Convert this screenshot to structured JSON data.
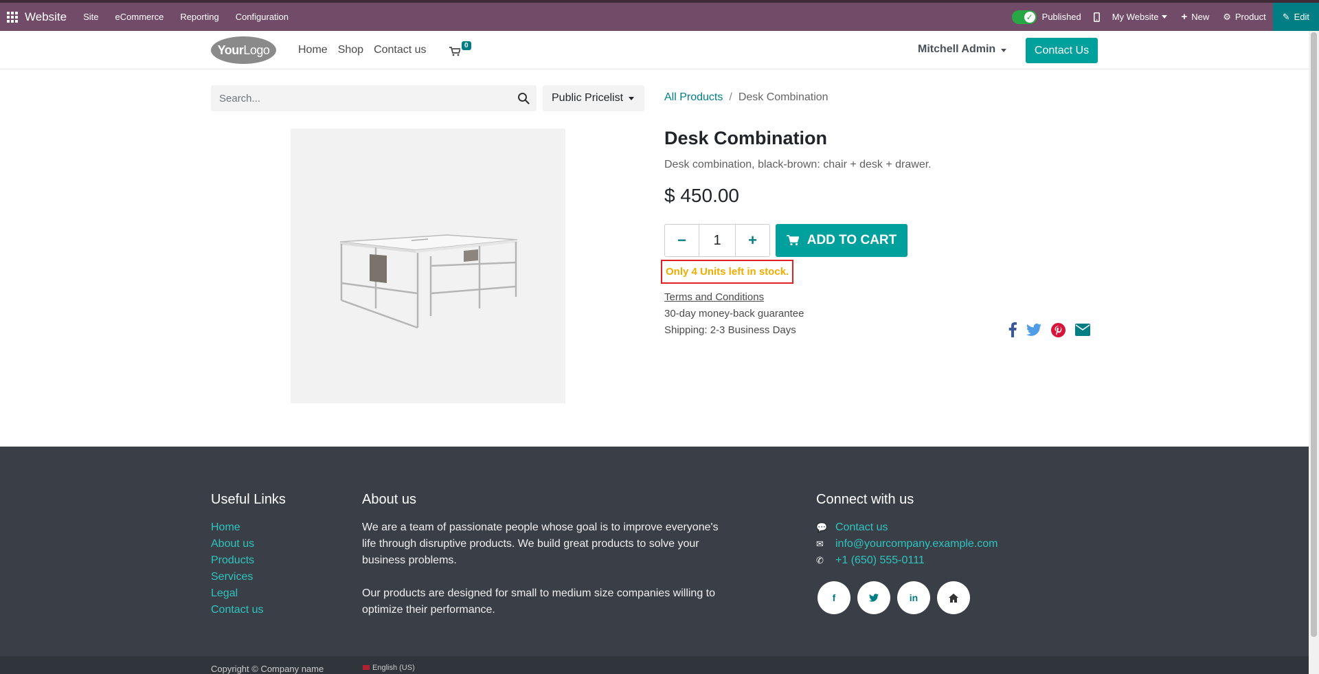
{
  "admin_bar": {
    "brand": "Website",
    "menus": [
      "Site",
      "eCommerce",
      "Reporting",
      "Configuration"
    ],
    "published_label": "Published",
    "my_website_label": "My Website",
    "new_label": "New",
    "product_label": "Product",
    "edit_label": "Edit"
  },
  "header": {
    "logo_text_bold": "Your",
    "logo_text_light": "Logo",
    "nav": [
      "Home",
      "Shop",
      "Contact us"
    ],
    "cart_count": "0",
    "user": "Mitchell Admin",
    "contact_button": "Contact Us"
  },
  "search": {
    "placeholder": "Search...",
    "pricelist": "Public Pricelist"
  },
  "breadcrumb": {
    "parent": "All Products",
    "current": "Desk Combination"
  },
  "product": {
    "title": "Desk Combination",
    "description": "Desk combination, black-brown: chair + desk + drawer.",
    "price": "$ 450.00",
    "quantity": "1",
    "add_to_cart": "ADD TO CART",
    "stock_message": "Only 4 Units left in stock.",
    "terms": "Terms and Conditions",
    "guarantee": "30-day money-back guarantee",
    "shipping": "Shipping: 2-3 Business Days"
  },
  "footer": {
    "useful_links_title": "Useful Links",
    "useful_links": [
      "Home",
      "About us",
      "Products",
      "Services",
      "Legal",
      "Contact us"
    ],
    "about_title": "About us",
    "about_p1": "We are a team of passionate people whose goal is to improve everyone's life through disruptive products. We build great products to solve your business problems.",
    "about_p2": "Our products are designed for small to medium size companies willing to optimize their performance.",
    "connect_title": "Connect with us",
    "contact_link": "Contact us",
    "email": "info@yourcompany.example.com",
    "phone": "+1 (650) 555-0111",
    "copyright": "Copyright © Company name",
    "language": "English (US)"
  },
  "colors": {
    "admin_bar": "#714b67",
    "primary": "#00a09d",
    "link": "#017e84",
    "stock_warning": "#f0ad00",
    "footer_bg": "#3a3f47"
  }
}
